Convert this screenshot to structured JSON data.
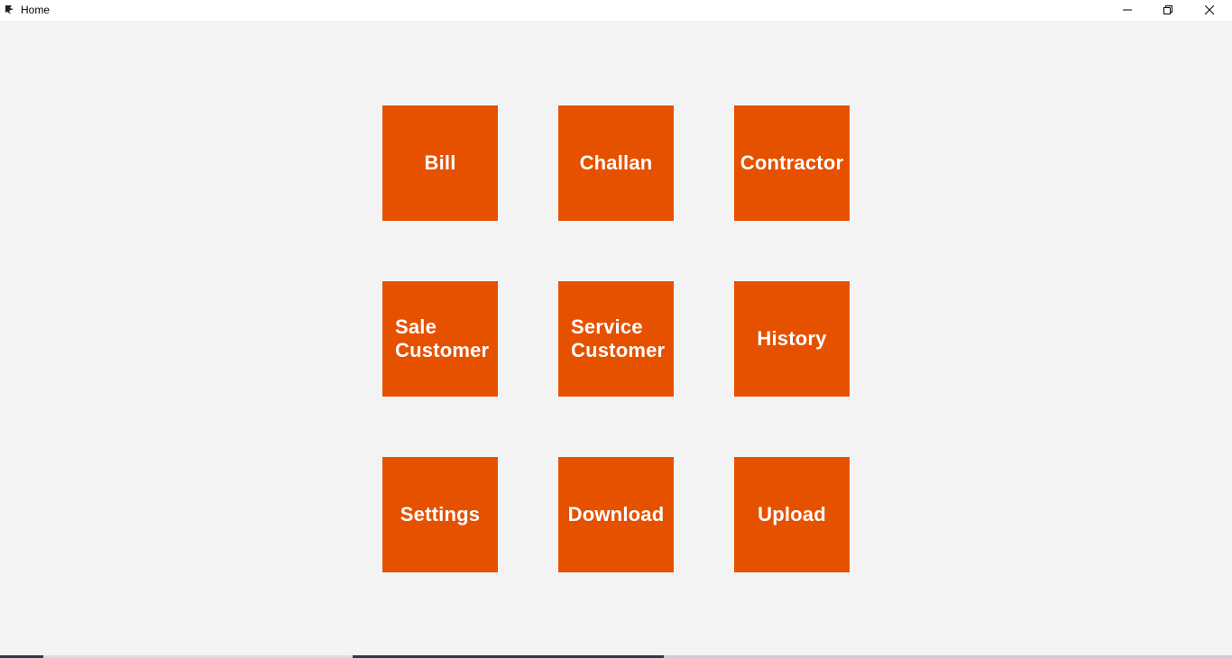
{
  "window": {
    "title": "Home",
    "controls": {
      "minimize": "minimize-icon",
      "restore": "restore-icon",
      "close": "close-icon"
    }
  },
  "theme": {
    "tile_color": "#e65100",
    "background": "#f3f3f3",
    "text_color": "#ffffff"
  },
  "tiles": [
    {
      "label": "Bill"
    },
    {
      "label": "Challan"
    },
    {
      "label": "Contractor"
    },
    {
      "label": "Sale\nCustomer"
    },
    {
      "label": "Service\nCustomer"
    },
    {
      "label": "History"
    },
    {
      "label": "Settings"
    },
    {
      "label": "Download"
    },
    {
      "label": "Upload"
    }
  ]
}
